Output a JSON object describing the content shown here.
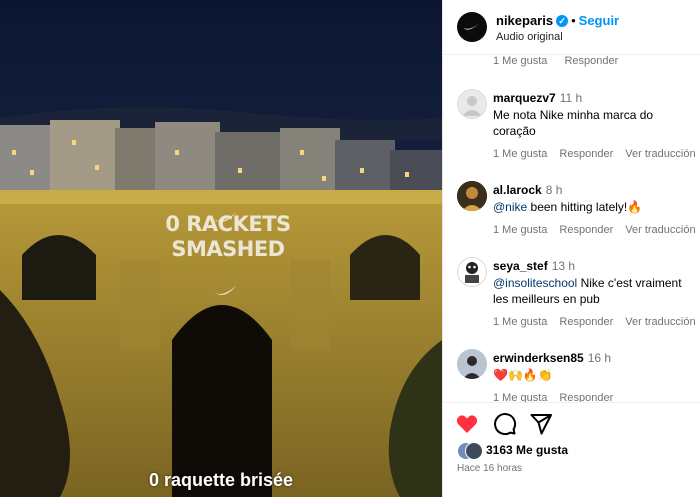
{
  "media": {
    "projection_lines": [
      "0 RACKETS",
      "SMASHED"
    ],
    "subtitle": "0 raquette brisée"
  },
  "post_header": {
    "username": "nikeparis",
    "verified": true,
    "separator": "•",
    "follow_label": "Seguir",
    "audio_label": "Audio original"
  },
  "top_actions": {
    "likes": "1 Me gusta",
    "reply": "Responder"
  },
  "comments": [
    {
      "username": "marquezv7",
      "time": "11 h",
      "text": "Me nota Nike minha marca do coração",
      "likes": "1 Me gusta",
      "reply": "Responder",
      "translate": "Ver traducción"
    },
    {
      "username": "al.larock",
      "time": "8 h",
      "mention": "@nike",
      "text": " been hitting lately!🔥",
      "likes": "1 Me gusta",
      "reply": "Responder",
      "translate": "Ver traducción"
    },
    {
      "username": "seya_stef",
      "time": "13 h",
      "mention": "@insoliteschool",
      "text": " Nike c'est vraiment les meilleurs en pub",
      "likes": "1 Me gusta",
      "reply": "Responder",
      "translate": "Ver traducción"
    },
    {
      "username": "erwinderksen85",
      "time": "16 h",
      "text": "❤️🙌🔥👏",
      "likes": "1 Me gusta",
      "reply": "Responder"
    }
  ],
  "post_footer": {
    "like_count": "3163 Me gusta",
    "time_ago": "Hace 16 horas"
  },
  "colors": {
    "accent_blue": "#0095f6",
    "like_red": "#ff3040",
    "mention": "#00376b",
    "muted_text": "#737373"
  },
  "icons": [
    "nike-swoosh-icon",
    "verified-icon",
    "heart-icon",
    "comment-icon",
    "share-icon"
  ]
}
